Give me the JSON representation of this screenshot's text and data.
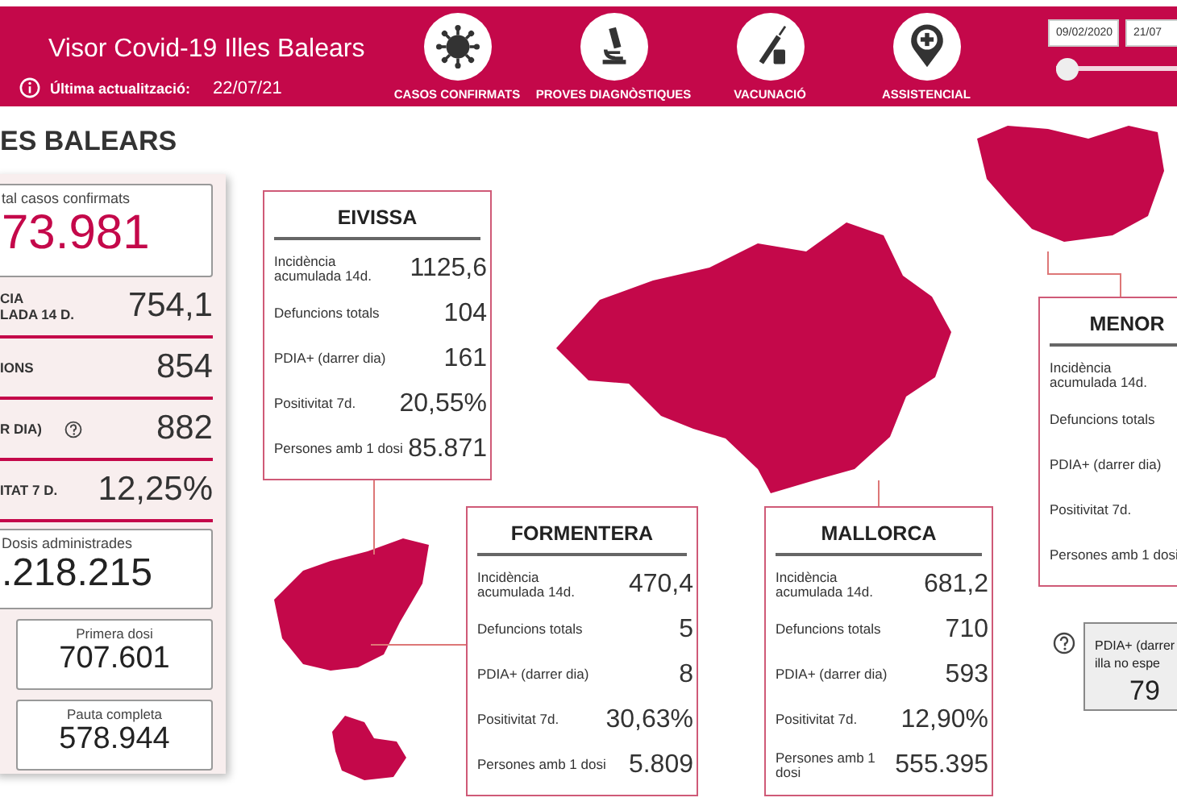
{
  "header": {
    "title": "Visor Covid-19 Illes Balears",
    "updated_label": "Última actualització:",
    "updated_value": "22/07/21",
    "nav": [
      {
        "kind": "virus",
        "label": "CASOS CONFIRMATS"
      },
      {
        "kind": "microscope",
        "label": "PROVES DIAGNÒSTIQUES"
      },
      {
        "kind": "syringe",
        "label": "VACUNACIÓ"
      },
      {
        "kind": "pin",
        "label": "ASSISTENCIAL"
      }
    ],
    "date_from": "09/02/2020",
    "date_to": "21/07",
    "slider": {
      "level": 0
    }
  },
  "region_title": "ES BALEARS",
  "totals": {
    "confirmed_label": "tal casos confirmats",
    "confirmed_value": "73.981",
    "stats": [
      {
        "lines": [
          "CIA",
          "LADA 14 D."
        ],
        "value": "754,1",
        "help": false
      },
      {
        "lines": [
          "IONS"
        ],
        "value": "854",
        "help": false
      },
      {
        "lines": [
          "R DIA)"
        ],
        "value": "882",
        "help": true
      },
      {
        "lines": [
          "ITAT 7 D."
        ],
        "value": "12,25%",
        "help": false
      }
    ],
    "doses_label": "Dosis administrades",
    "doses_value": ".218.215",
    "first_dose": {
      "label": "Primera dosi",
      "value": "707.601"
    },
    "full_dose": {
      "label": "Pauta completa",
      "value": "578.944"
    }
  },
  "islands": [
    {
      "name": "EIVISSA",
      "rows": [
        {
          "label": "Incidència acumulada 14d.",
          "value": "1125,6"
        },
        {
          "label": "Defuncions totals",
          "value": "104"
        },
        {
          "label": "PDIA+ (darrer dia)",
          "value": "161"
        },
        {
          "label": "Positivitat 7d.",
          "value": "20,55%"
        },
        {
          "label": "Persones amb 1 dosi",
          "value": "85.871"
        }
      ]
    },
    {
      "name": "FORMENTERA",
      "rows": [
        {
          "label": "Incidència acumulada 14d.",
          "value": "470,4"
        },
        {
          "label": "Defuncions totals",
          "value": "5"
        },
        {
          "label": "PDIA+ (darrer dia)",
          "value": "8"
        },
        {
          "label": "Positivitat 7d.",
          "value": "30,63%"
        },
        {
          "label": "Persones amb 1 dosi",
          "value": "5.809"
        }
      ]
    },
    {
      "name": "MALLORCA",
      "rows": [
        {
          "label": "Incidència acumulada 14d.",
          "value": "681,2"
        },
        {
          "label": "Defuncions totals",
          "value": "710"
        },
        {
          "label": "PDIA+ (darrer dia)",
          "value": "593"
        },
        {
          "label": "Positivitat 7d.",
          "value": "12,90%"
        },
        {
          "label": "Persones amb 1 dosi",
          "value": "555.395"
        }
      ]
    },
    {
      "name": "MENOR",
      "rows": [
        {
          "label": "Incidència acumulada 14d."
        },
        {
          "label": "Defuncions totals"
        },
        {
          "label": "PDIA+ (darrer dia)"
        },
        {
          "label": "Positivitat 7d."
        },
        {
          "label": "Persones amb 1 dosi"
        }
      ]
    }
  ],
  "note": {
    "lines": [
      "PDIA+ (darrer",
      "illa no espe"
    ],
    "value": "79"
  }
}
